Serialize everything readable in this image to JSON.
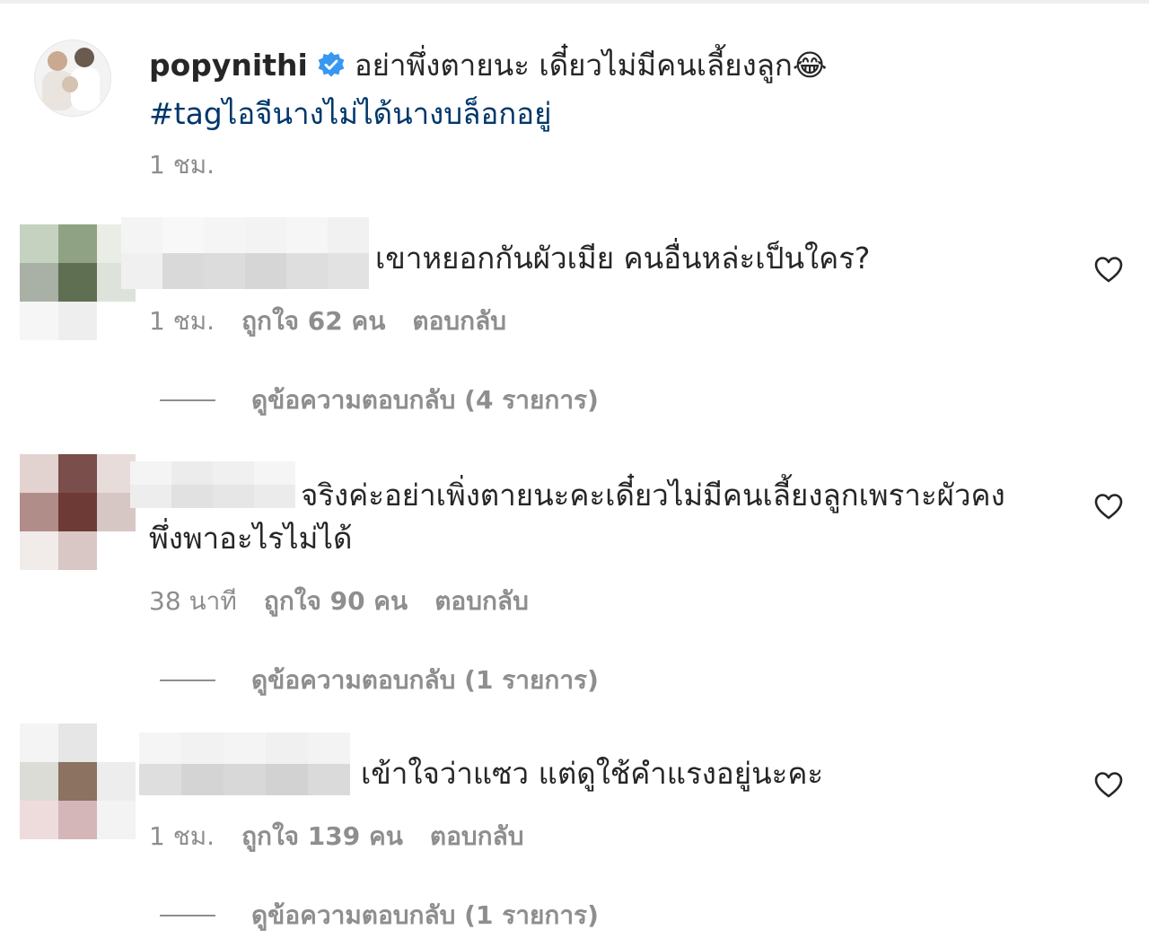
{
  "caption": {
    "username": "popynithi",
    "text": "อย่าพึ่งตายนะ เดี๋ยวไม่มีคนเลี้ยงลูก😂",
    "hashtag": "#tagไอจีนางไม่ได้นางบล็อกอยู่",
    "time": "1 ชม."
  },
  "comments": [
    {
      "text": "เขาหยอกกันผัวเมีย คนอื่นหล่ะเป็นใคร?",
      "time": "1 ชม.",
      "likes": "ถูกใจ 62 คน",
      "reply_label": "ตอบกลับ",
      "view_replies": "ดูข้อความตอบกลับ (4 รายการ)"
    },
    {
      "text_line1": "จริงค่ะอย่าเพิ่งตายนะคะเดี๋ยวไม่มีคนเลี้ยงลูกเพราะผัวคง",
      "text_line2": "พึ่งพาอะไรไม่ได้",
      "time": "38 นาที",
      "likes": "ถูกใจ 90 คน",
      "reply_label": "ตอบกลับ",
      "view_replies": "ดูข้อความตอบกลับ (1 รายการ)"
    },
    {
      "text": "เข้าใจว่าแซว แต่ดูใช้คำแรงอยู่นะคะ",
      "time": "1 ชม.",
      "likes": "ถูกใจ 139 คน",
      "reply_label": "ตอบกลับ",
      "view_replies": "ดูข้อความตอบกลับ (1 รายการ)"
    }
  ],
  "icons": {
    "verified": "verified-badge-icon",
    "like": "heart-icon"
  },
  "colors": {
    "verified": "#3897f0",
    "hashtag": "#00376b",
    "muted": "#8e8e8e",
    "text": "#262626"
  }
}
